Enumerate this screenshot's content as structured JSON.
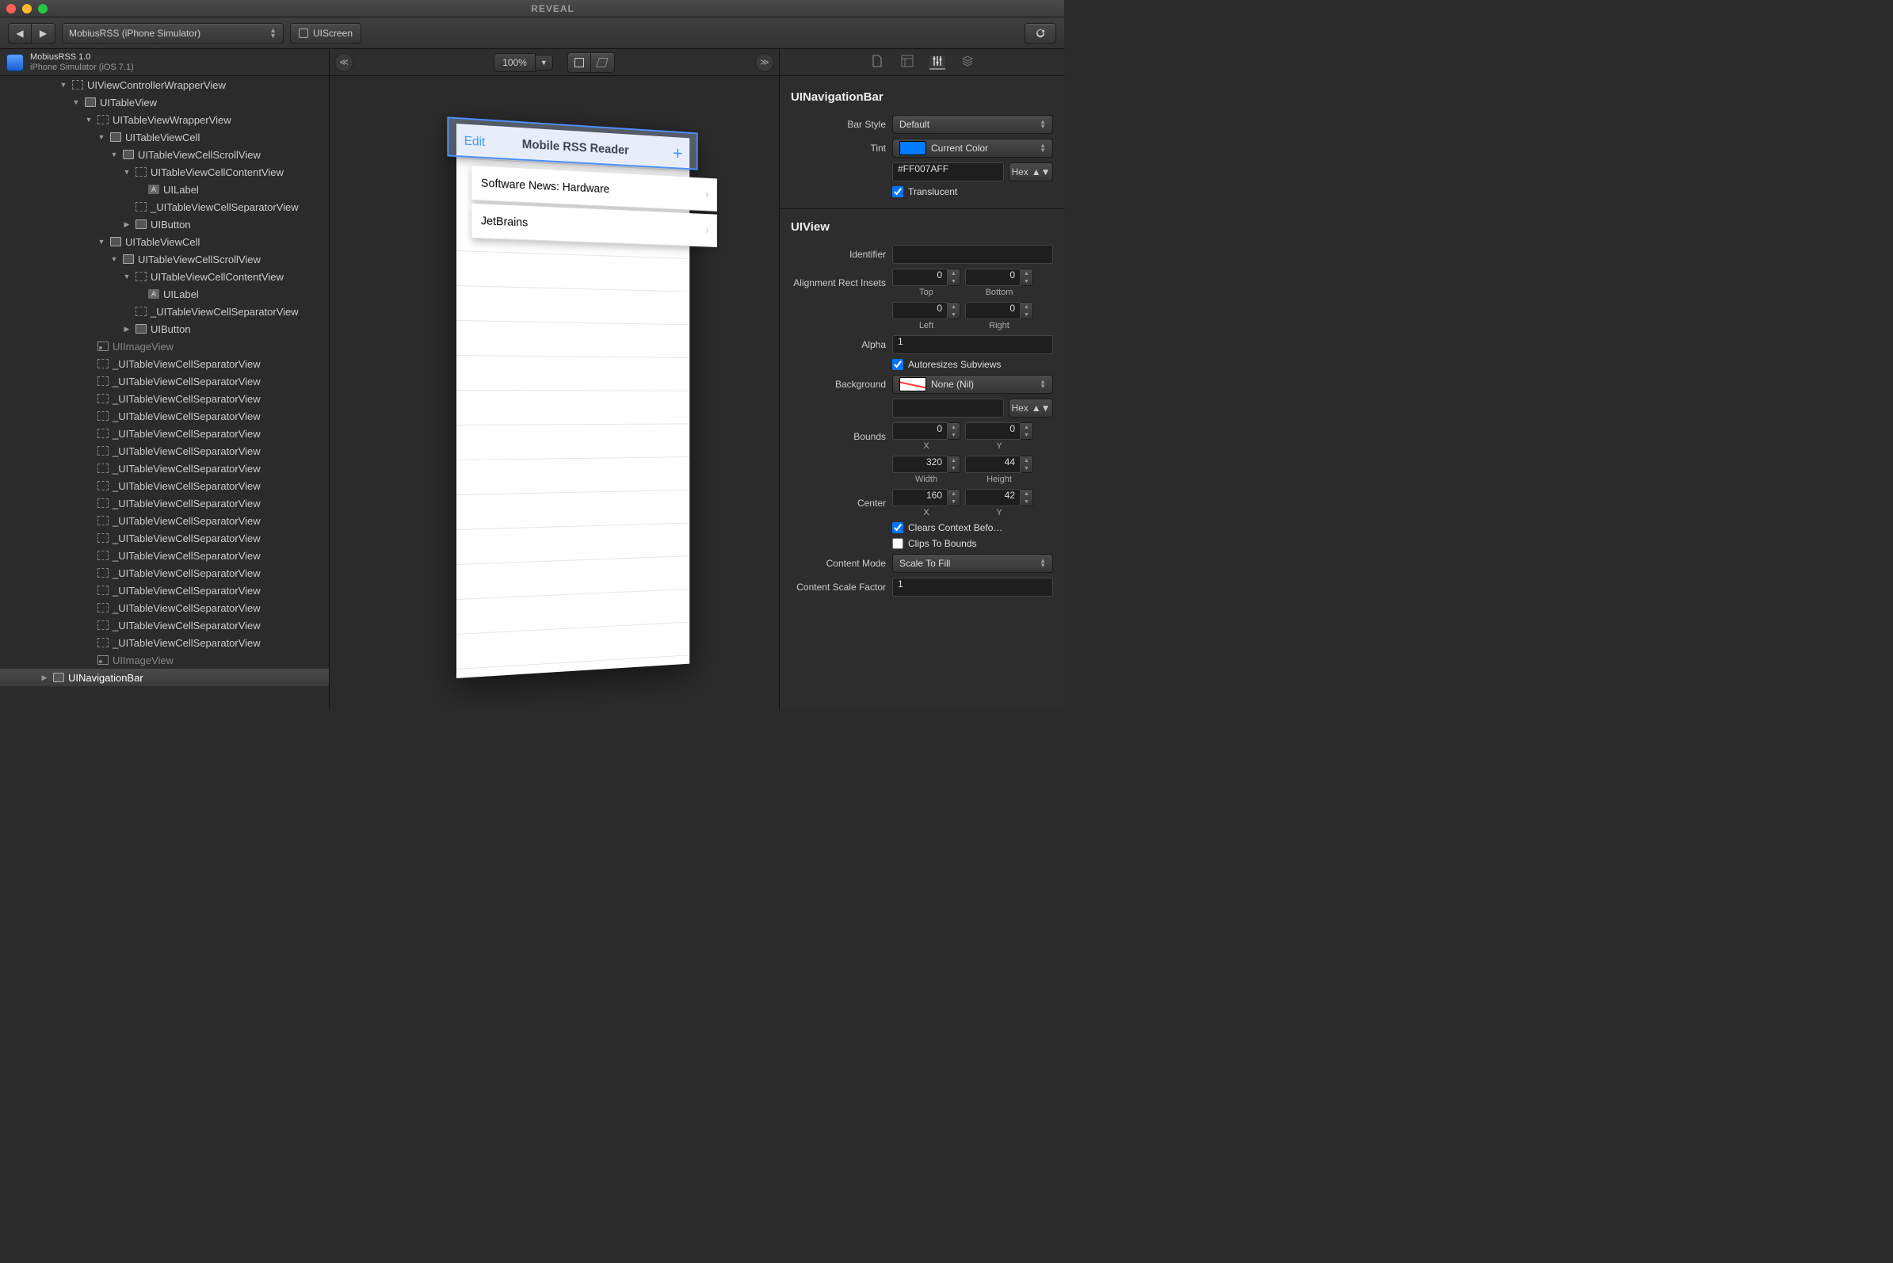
{
  "window": {
    "title": "REVEAL"
  },
  "toolbar": {
    "target": "MobiusRSS (iPhone Simulator)",
    "breadcrumb": "UIScreen"
  },
  "app": {
    "name": "MobiusRSS 1.0",
    "device": "iPhone Simulator (iOS 7.1)"
  },
  "zoom": "100%",
  "hierarchy": {
    "n0": "UIViewControllerWrapperView",
    "n1": "UITableView",
    "n2": "UITableViewWrapperView",
    "n3": "UITableViewCell",
    "n4": "UITableViewCellScrollView",
    "n5": "UITableViewCellContentView",
    "n6": "UILabel",
    "n7": "_UITableViewCellSeparatorView",
    "n8": "UIButton",
    "n9": "UITableViewCell",
    "n10": "UITableViewCellScrollView",
    "n11": "UITableViewCellContentView",
    "n12": "UILabel",
    "n13": "_UITableViewCellSeparatorView",
    "n14": "UIButton",
    "n15": "UIImageView",
    "sep": "_UITableViewCellSeparatorView",
    "n_img2": "UIImageView",
    "nsel": "UINavigationBar"
  },
  "preview": {
    "edit": "Edit",
    "title": "Mobile RSS Reader",
    "plus": "+",
    "cell1": "Software News: Hardware",
    "cell2": "JetBrains"
  },
  "inspector": {
    "sect1": "UINavigationBar",
    "barStyle_l": "Bar Style",
    "barStyle_v": "Default",
    "tint_l": "Tint",
    "tint_v": "Current Color",
    "tintHex": "#FF007AFF",
    "hex_l": "Hex",
    "translucent_l": "Translucent",
    "sect2": "UIView",
    "identifier_l": "Identifier",
    "identifier_v": "",
    "insets_l": "Alignment Rect Insets",
    "top_l": "Top",
    "top_v": "0",
    "bottom_l": "Bottom",
    "bottom_v": "0",
    "left_l": "Left",
    "left_v": "0",
    "right_l": "Right",
    "right_v": "0",
    "alpha_l": "Alpha",
    "alpha_v": "1",
    "autoresize_l": "Autoresizes Subviews",
    "background_l": "Background",
    "background_v": "None (Nil)",
    "bounds_l": "Bounds",
    "bx_l": "X",
    "bx_v": "0",
    "by_l": "Y",
    "by_v": "0",
    "bw_l": "Width",
    "bw_v": "320",
    "bh_l": "Height",
    "bh_v": "44",
    "center_l": "Center",
    "cx_l": "X",
    "cx_v": "160",
    "cy_l": "Y",
    "cy_v": "42",
    "clears_l": "Clears Context Befo…",
    "clips_l": "Clips To Bounds",
    "cmode_l": "Content Mode",
    "cmode_v": "Scale To Fill",
    "scale_l": "Content Scale Factor",
    "scale_v": "1"
  }
}
